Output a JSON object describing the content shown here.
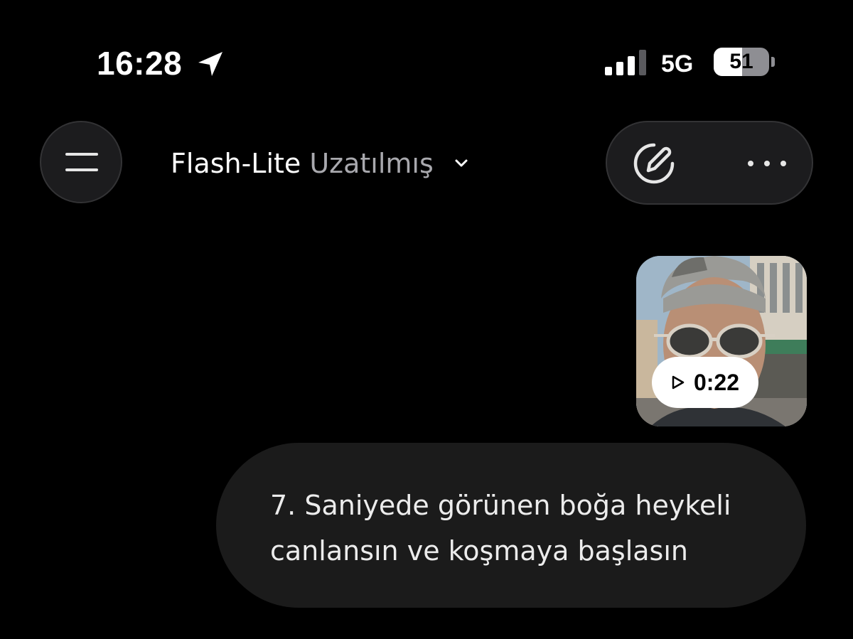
{
  "status_bar": {
    "time": "16:28",
    "location_icon": "location-arrow-icon",
    "signal_icon": "cellular-signal-icon",
    "network": "5G",
    "battery_level": "51",
    "battery_fraction": 0.51
  },
  "header": {
    "menu_icon": "menu-icon",
    "model_name": "Flash-Lite",
    "model_variant": "Uzatılmış",
    "dropdown_icon": "chevron-down-icon",
    "new_chat_icon": "edit-icon",
    "more_icon": "more-horizontal-icon"
  },
  "chat": {
    "video_attachment": {
      "duration": "0:22",
      "play_icon": "play-icon"
    },
    "user_message": "7. Saniyede görünen boğa heykeli\ncanlansın ve koşmaya başlasın"
  },
  "colors": {
    "background": "#000000",
    "surface": "#1c1c1e",
    "secondary_text": "#a9a9ae"
  }
}
